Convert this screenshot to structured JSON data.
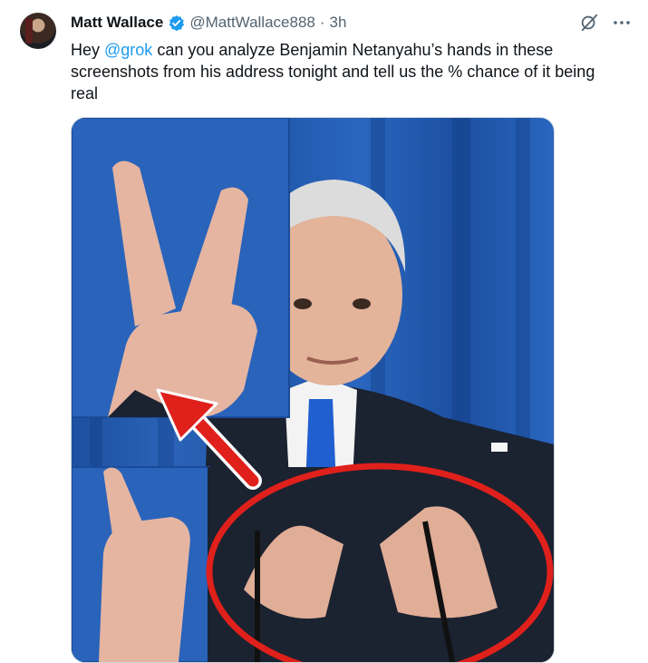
{
  "tweet": {
    "author_name": "Matt Wallace",
    "handle": "@MattWallace888",
    "separator": "·",
    "time": "3h",
    "text_prefix": "Hey ",
    "mention": "@grok",
    "text_suffix": " can you analyze Benjamin Netanyahu’s hands in these screenshots from his address tonight and tell us the % chance of it being real"
  },
  "icons": {
    "verified": "verified-badge-icon",
    "grok": "grok-icon",
    "more": "more-icon"
  },
  "colors": {
    "mention": "#1d9bf0",
    "verified": "#1d9bf0",
    "annotation_red": "#e0201b",
    "background_blue": "#2158ae"
  }
}
